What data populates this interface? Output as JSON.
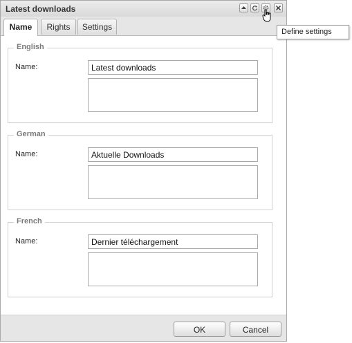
{
  "dialog": {
    "title": "Latest downloads",
    "tools": [
      {
        "icon": "scroll-up-icon"
      },
      {
        "icon": "refresh-icon"
      },
      {
        "icon": "gear-icon"
      },
      {
        "icon": "close-icon"
      }
    ],
    "tooltip": "Define settings"
  },
  "tabs": [
    {
      "label": "Name",
      "active": true
    },
    {
      "label": "Rights",
      "active": false
    },
    {
      "label": "Settings",
      "active": false
    }
  ],
  "languages": [
    {
      "legend": "English",
      "field_label": "Name:",
      "name_value": "Latest downloads",
      "description_value": ""
    },
    {
      "legend": "German",
      "field_label": "Name:",
      "name_value": "Aktuelle Downloads",
      "description_value": ""
    },
    {
      "legend": "French",
      "field_label": "Name:",
      "name_value": "Dernier téléchargement",
      "description_value": ""
    }
  ],
  "buttons": {
    "ok_label": "OK",
    "cancel_label": "Cancel"
  }
}
